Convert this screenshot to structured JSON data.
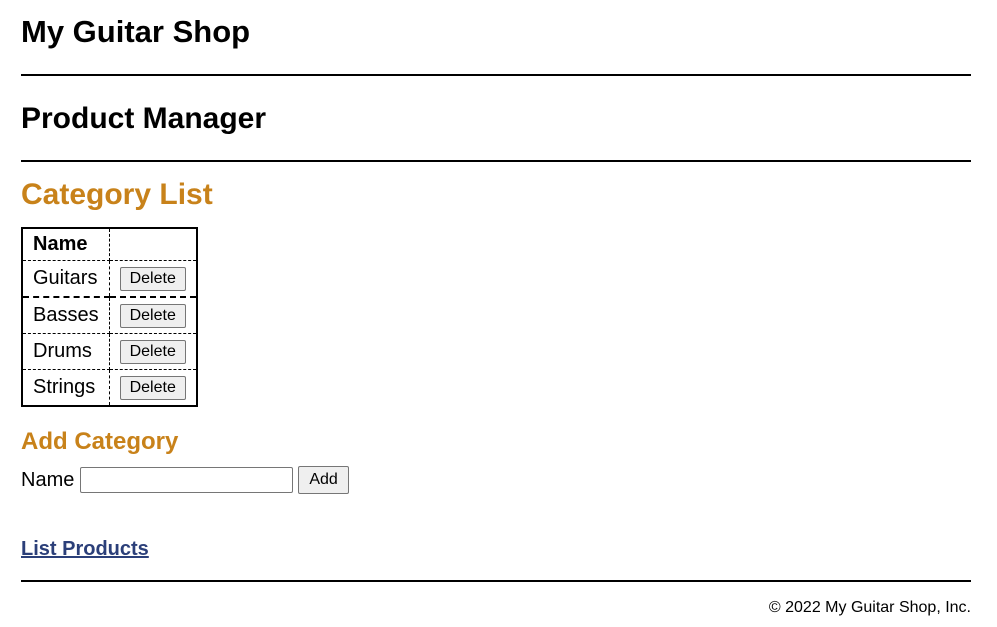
{
  "header": {
    "shop_title": "My Guitar Shop"
  },
  "main": {
    "manager_title": "Product Manager",
    "category_list_title": "Category List",
    "table": {
      "columns": [
        "Name",
        ""
      ],
      "rows": [
        {
          "name": "Guitars",
          "action_label": "Delete"
        },
        {
          "name": "Basses",
          "action_label": "Delete"
        },
        {
          "name": "Drums",
          "action_label": "Delete"
        },
        {
          "name": "Strings",
          "action_label": "Delete"
        }
      ]
    },
    "add_category": {
      "title": "Add Category",
      "name_label": "Name",
      "name_value": "",
      "name_placeholder": "",
      "add_label": "Add"
    },
    "list_products_link": "List Products"
  },
  "footer": {
    "copyright": "© 2022 My Guitar Shop, Inc."
  },
  "colors": {
    "heading_accent": "#c8821a",
    "link": "#2b3f79",
    "text": "#000000",
    "background": "#ffffff"
  }
}
